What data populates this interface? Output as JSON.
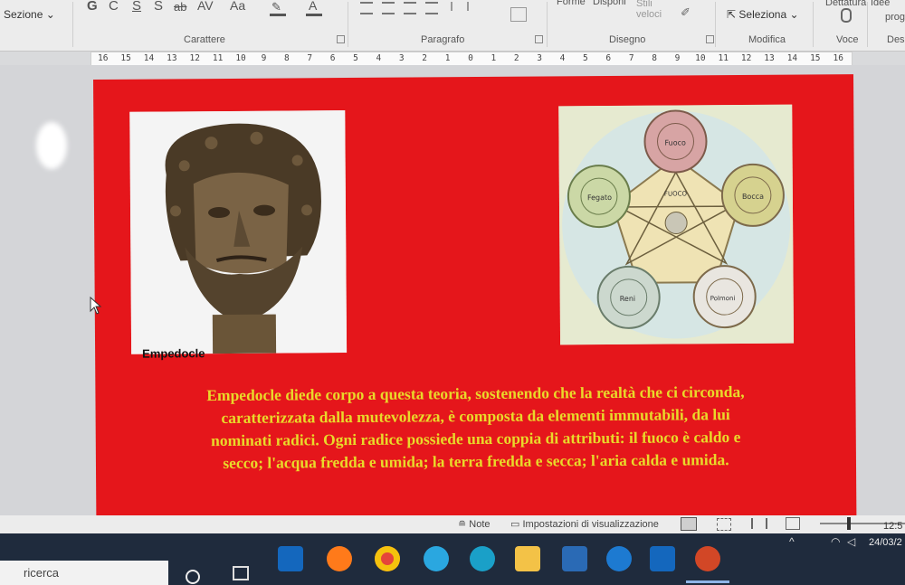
{
  "ribbon": {
    "sections_label": "Sezione",
    "font_buttons": [
      "G",
      "C",
      "S",
      "S",
      "ab",
      "AV",
      "Aa"
    ],
    "shapes_label": "Forme",
    "arrange_label": "Disponi",
    "quick_styles_label": "Stili veloci",
    "select_label": "Seleziona",
    "dictation_label": "Dettatura",
    "ideas_label": "Idee",
    "ideas_sub": "prog",
    "groups": {
      "font": "Carattere",
      "paragraph": "Paragrafo",
      "drawing": "Disegno",
      "editing": "Modifica",
      "voice": "Voce",
      "designer": "Desi"
    }
  },
  "ruler": {
    "marks": [
      "16",
      "15",
      "14",
      "13",
      "12",
      "11",
      "10",
      "9",
      "8",
      "7",
      "6",
      "5",
      "4",
      "3",
      "2",
      "1",
      "0",
      "1",
      "2",
      "3",
      "4",
      "5",
      "6",
      "7",
      "8",
      "9",
      "10",
      "11",
      "12",
      "13",
      "14",
      "15",
      "16"
    ]
  },
  "slide": {
    "background": "#e5161b",
    "text_color": "#e9d92a",
    "portrait_caption": "Empedocle",
    "wheel_labels": {
      "top": "Fuoco",
      "right": "Bocca",
      "bottom_right": "Polmoni",
      "bottom_left": "Reni",
      "left": "Fegato",
      "center": "FUOCO"
    },
    "body_lines": [
      "Empedocle diede corpo a questa teoria, sostenendo che la realtà che ci circonda,",
      "caratterizzata dalla mutevolezza, è composta da elementi immutabili, da lui",
      "nominati radici. Ogni radice possiede una coppia di attributi: il fuoco è caldo e",
      "secco; l'acqua fredda e umida; la terra fredda e secca; l'aria calda e umida."
    ]
  },
  "statusbar": {
    "notes_label": "Note",
    "view_settings_label": "Impostazioni di visualizzazione"
  },
  "taskbar": {
    "search_placeholder": "ricerca",
    "clock_time": "12:5",
    "clock_date": "24/03/2"
  }
}
